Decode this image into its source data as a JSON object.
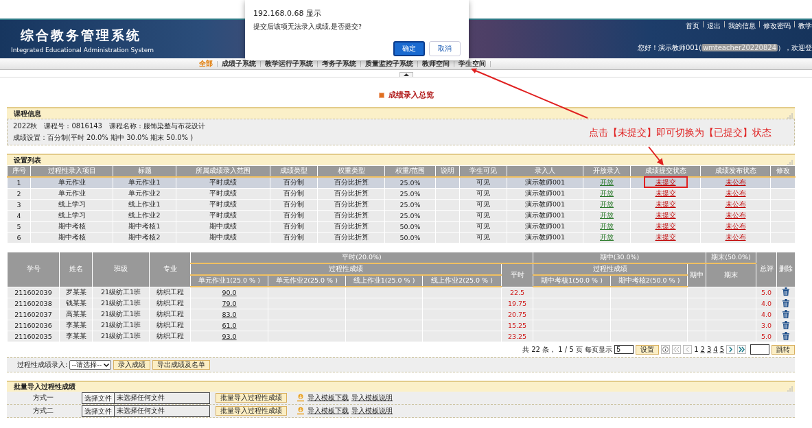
{
  "dialog": {
    "title": "192.168.0.68 显示",
    "message": "提交后该项无法录入成绩,是否提交?",
    "buttons": [
      {
        "label": "确定",
        "primary": true
      },
      {
        "label": "取消",
        "primary": false
      }
    ]
  },
  "header": {
    "title": "综合教务管理系统",
    "subtitle": "Integrated Educational Administration System",
    "links": [
      "首页",
      "退出",
      "我的信息",
      "修改密码",
      "教学"
    ],
    "greeting": "您好！演示教师001(",
    "user": "wmteacher20220824",
    "greeting_end": "），欢迎登"
  },
  "nav": [
    {
      "label": "全部",
      "selected": true
    },
    {
      "label": "成绩子系统",
      "selected": false
    },
    {
      "label": "教学运行子系统",
      "selected": false
    },
    {
      "label": "考务子系统",
      "selected": false
    },
    {
      "label": "质量监控子系统",
      "selected": false
    },
    {
      "label": "教师空间",
      "selected": false
    },
    {
      "label": "学生空间",
      "selected": false
    }
  ],
  "page_title": "成绩录入总览",
  "annotation": "点击【未提交】即可切换为【已提交】状态",
  "course_info": {
    "title": "课程信息",
    "lines": [
      "2022秋　课程号：0816143　课程名称：服饰染整与布花设计",
      "成绩设置：百分制(平时 20.0% 期中 30.0% 期末 50.0% )"
    ]
  },
  "settings": {
    "title": "设置列表",
    "columns": [
      "序号",
      "过程性录入项目",
      "标题",
      "所属成绩录入范围",
      "成绩类型",
      "权重类型",
      "权重/范围",
      "说明",
      "学生可见",
      "录入人",
      "开放录入",
      "成绩提交状态",
      "成绩发布状态",
      "修改"
    ],
    "rows": [
      {
        "no": "1",
        "item": "单元作业",
        "title": "单元作业1",
        "range": "平时成绩",
        "type": "百分制",
        "weight_type": "百分比折算",
        "weight": "25.0%",
        "visible": "可见",
        "author": "演示教师001",
        "open": "开放",
        "submit": "未提交",
        "publish": "未公布",
        "selected": true,
        "boxed": true
      },
      {
        "no": "2",
        "item": "单元作业",
        "title": "单元作业2",
        "range": "平时成绩",
        "type": "百分制",
        "weight_type": "百分比折算",
        "weight": "25.0%",
        "visible": "可见",
        "author": "演示教师001",
        "open": "开放",
        "submit": "未提交",
        "publish": "未公布",
        "selected": false,
        "boxed": false
      },
      {
        "no": "3",
        "item": "线上学习",
        "title": "线上作业1",
        "range": "平时成绩",
        "type": "百分制",
        "weight_type": "百分比折算",
        "weight": "25.0%",
        "visible": "可见",
        "author": "演示教师001",
        "open": "开放",
        "submit": "未提交",
        "publish": "未公布",
        "selected": false,
        "boxed": false
      },
      {
        "no": "4",
        "item": "线上学习",
        "title": "线上作业2",
        "range": "平时成绩",
        "type": "百分制",
        "weight_type": "百分比折算",
        "weight": "25.0%",
        "visible": "可见",
        "author": "演示教师001",
        "open": "开放",
        "submit": "未提交",
        "publish": "未公布",
        "selected": false,
        "boxed": false
      },
      {
        "no": "5",
        "item": "期中考核",
        "title": "期中考核1",
        "range": "期中成绩",
        "type": "百分制",
        "weight_type": "百分比折算",
        "weight": "50.0%",
        "visible": "可见",
        "author": "演示教师001",
        "open": "开放",
        "submit": "未提交",
        "publish": "未公布",
        "selected": false,
        "boxed": false
      },
      {
        "no": "6",
        "item": "期中考核",
        "title": "期中考核2",
        "range": "期中成绩",
        "type": "百分制",
        "weight_type": "百分比折算",
        "weight": "50.0%",
        "visible": "可见",
        "author": "演示教师001",
        "open": "开放",
        "submit": "未提交",
        "publish": "未公布",
        "selected": false,
        "boxed": false
      }
    ]
  },
  "scores": {
    "student_columns": [
      "学号",
      "姓名",
      "班级",
      "专业"
    ],
    "usual": {
      "title": "平时(20.0%)",
      "process_title": "过程性成绩",
      "items": [
        "单元作业1(25.0 % )",
        "单元作业2(25.0 % )",
        "线上作业1(25.0 % )",
        "线上作业2(25.0 % )"
      ],
      "total_title": "平时"
    },
    "midterm": {
      "title": "期中(30.0%)",
      "process_title": "过程性成绩",
      "items": [
        "期中考核1(50.0 % )",
        "期中考核2(50.0 % )"
      ],
      "total_title": "期中"
    },
    "final": {
      "title": "期末(50.0%)",
      "total_title": "期末"
    },
    "overall_title": "总评",
    "delete_title": "删除",
    "rows": [
      {
        "id": "211602039",
        "name": "罗某某",
        "class": "21级纺工1班",
        "major": "纺织工程",
        "process": [
          "90.0"
        ],
        "usual": "22.5",
        "overall": "5.0"
      },
      {
        "id": "211602038",
        "name": "钱某某",
        "class": "21级纺工1班",
        "major": "纺织工程",
        "process": [
          "79.0"
        ],
        "usual": "19.75",
        "overall": "4.0"
      },
      {
        "id": "211602037",
        "name": "高某某",
        "class": "21级纺工1班",
        "major": "纺织工程",
        "process": [
          "83.0"
        ],
        "usual": "20.75",
        "overall": "4.0"
      },
      {
        "id": "211602036",
        "name": "李某某",
        "class": "21级纺工1班",
        "major": "纺织工程",
        "process": [
          "61.0"
        ],
        "usual": "15.25",
        "overall": "3.0"
      },
      {
        "id": "211602035",
        "name": "李某某",
        "class": "21级纺工1班",
        "major": "纺织工程",
        "process": [
          "93.0"
        ],
        "usual": "23.25",
        "overall": "5.0"
      }
    ]
  },
  "pagination": {
    "summary": "共 22 条， 1 / 5 页 每页显示",
    "per_page": "5",
    "set_button": "设置",
    "pages": [
      {
        "label": "1",
        "selected": true
      },
      {
        "label": "2",
        "selected": false
      },
      {
        "label": "3",
        "selected": false
      },
      {
        "label": "4",
        "selected": false
      },
      {
        "label": "5",
        "selected": false
      }
    ],
    "jump_button": "跳转"
  },
  "entry": {
    "label": "过程性成绩录入:",
    "select": "--请选择--",
    "buttons": [
      "录入成绩",
      "导出成绩及名单"
    ]
  },
  "batch": {
    "title": "批量导入过程性成绩",
    "rows": [
      {
        "label": "方式一",
        "file_button": "选择文件",
        "file_status": "未选择任何文件",
        "import_button": "批量导入过程性成绩",
        "download": "导入模板下载",
        "help": "导入模板说明"
      },
      {
        "label": "方式二",
        "file_button": "选择文件",
        "file_status": "未选择任何文件",
        "import_button": "批量导入过程性成绩",
        "download": "导入模板下载",
        "help": "导入模板说明"
      }
    ]
  }
}
